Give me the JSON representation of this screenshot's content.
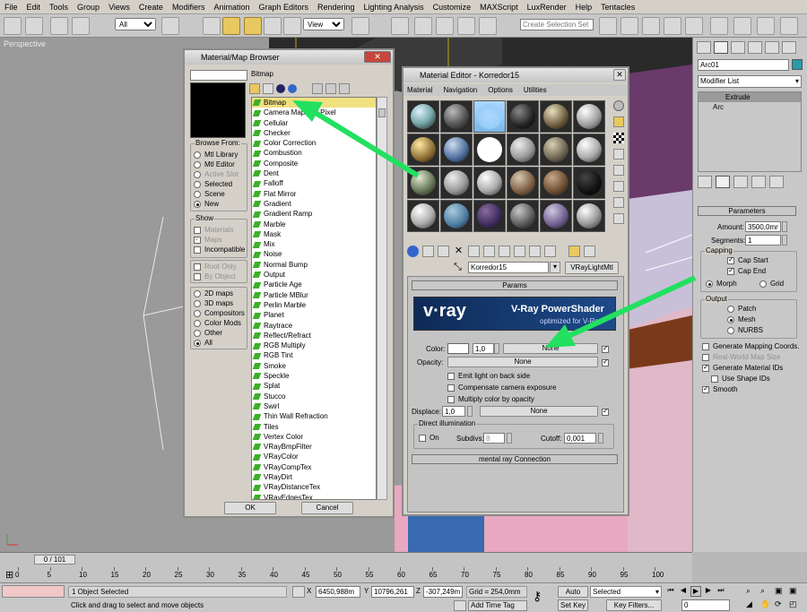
{
  "menu": [
    "File",
    "Edit",
    "Tools",
    "Group",
    "Views",
    "Create",
    "Modifiers",
    "Animation",
    "Graph Editors",
    "Rendering",
    "Lighting Analysis",
    "Customize",
    "MAXScript",
    "LuxRender",
    "Help",
    "Tentacles"
  ],
  "toolbar": {
    "filter": "All",
    "refcoord": "View",
    "selset_placeholder": "Create Selection Set"
  },
  "viewport": {
    "label": "Perspective"
  },
  "browser": {
    "title": "Material/Map Browser",
    "search": "",
    "selected_name": "Bitmap",
    "browse_from": {
      "label": "Browse From:",
      "options": [
        "Mtl Library",
        "Mtl Editor",
        "Active Slot",
        "Selected",
        "Scene",
        "New"
      ],
      "selected": "New"
    },
    "show": {
      "label": "Show",
      "options": [
        "Materials",
        "Maps",
        "Incompatible"
      ]
    },
    "root_only": "Root Only",
    "by_object": "By Object",
    "types": [
      "2D maps",
      "3D maps",
      "Compositors",
      "Color Mods",
      "Other",
      "All"
    ],
    "types_selected": "All",
    "maps": [
      "Bitmap",
      "Camera Map Per Pixel",
      "Cellular",
      "Checker",
      "Color Correction",
      "Combustion",
      "Composite",
      "Dent",
      "Falloff",
      "Flat Mirror",
      "Gradient",
      "Gradient Ramp",
      "Marble",
      "Mask",
      "Mix",
      "Noise",
      "Normal Bump",
      "Output",
      "Particle Age",
      "Particle MBlur",
      "Perlin Marble",
      "Planet",
      "Raytrace",
      "Reflect/Refract",
      "RGB Multiply",
      "RGB Tint",
      "Smoke",
      "Speckle",
      "Splat",
      "Stucco",
      "Swirl",
      "Thin Wall Refraction",
      "Tiles",
      "Vertex Color",
      "VRayBmpFilter",
      "VRayColor",
      "VRayCompTex",
      "VRayDirt",
      "VRayDistanceTex",
      "VRayEdgesTex"
    ],
    "ok": "OK",
    "cancel": "Cancel"
  },
  "editor": {
    "title": "Material Editor - Korredor15",
    "menus": [
      "Material",
      "Navigation",
      "Options",
      "Utilities"
    ],
    "mtl_name": "Korredor15",
    "mtl_type": "VRayLightMtl",
    "params_header": "Params",
    "banner_logo": "v·ray",
    "banner_title": "V-Ray PowerShader",
    "banner_sub": "optimized for V-Ray",
    "color_label": "Color:",
    "color_value": "1,0",
    "none": "None",
    "opacity_label": "Opacity:",
    "emit_back": "Emit light on back side",
    "comp_exposure": "Compensate camera exposure",
    "mult_opacity": "Multiply color by opacity",
    "displace_label": "Displace:",
    "displace_value": "1,0",
    "direct_label": "Direct illumination",
    "on": "On",
    "subdivs_label": "Subdivs:",
    "subdivs": "8",
    "cutoff_label": "Cutoff:",
    "cutoff": "0,001",
    "mr_connection": "mental ray Connection"
  },
  "cmd": {
    "object_name": "Arc01",
    "modifier_list": "Modifier List",
    "stack": [
      "Extrude",
      "Arc"
    ],
    "parameters": "Parameters",
    "amount_label": "Amount:",
    "amount": "3500,0mm",
    "segments_label": "Segments:",
    "segments": "1",
    "capping": "Capping",
    "cap_start": "Cap Start",
    "cap_end": "Cap End",
    "morph": "Morph",
    "grid": "Grid",
    "output": "Output",
    "patch": "Patch",
    "mesh": "Mesh",
    "nurbs": "NURBS",
    "gen_mapping": "Generate Mapping Coords.",
    "real_world": "Real-World Map Size",
    "gen_matids": "Generate Material IDs",
    "use_shapeids": "Use Shape IDs",
    "smooth": "Smooth"
  },
  "timeline": {
    "frame": "0 / 101",
    "ticks": [
      "0",
      "5",
      "10",
      "15",
      "20",
      "25",
      "30",
      "35",
      "40",
      "45",
      "50",
      "55",
      "60",
      "65",
      "70",
      "75",
      "80",
      "85",
      "90",
      "95",
      "100"
    ]
  },
  "status": {
    "objects": "1 Object Selected",
    "hint": "Click and drag to select and move objects",
    "x": "6450,988m",
    "y": "10796,261",
    "z": "-307,249m",
    "grid": "Grid = 254,0mm",
    "add_time_tag": "Add Time Tag",
    "auto_key": "Auto Key",
    "set_key": "Set Key",
    "selected": "Selected",
    "key_filters": "Key Filters...",
    "frame": "0"
  }
}
